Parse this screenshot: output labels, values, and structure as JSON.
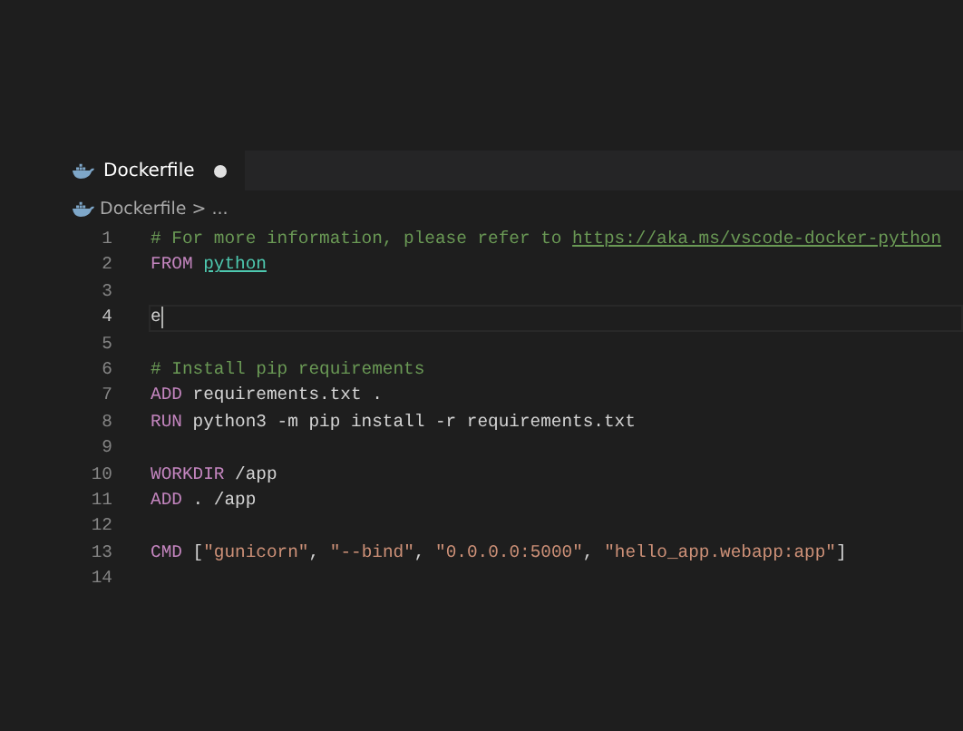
{
  "tabs": [
    {
      "label": "Dockerfile",
      "selected": true,
      "modified": true
    }
  ],
  "breadcrumb": {
    "file": "Dockerfile",
    "separator": ">",
    "more": "..."
  },
  "lines": [
    {
      "number": "1",
      "tokens": [
        {
          "kind": "comment",
          "text": "# For more information, please refer to "
        },
        {
          "kind": "link",
          "text": "https://aka.ms/vscode-docker-python"
        }
      ]
    },
    {
      "number": "2",
      "tokens": [
        {
          "kind": "keyword",
          "text": "FROM "
        },
        {
          "kind": "image",
          "text": "python"
        }
      ]
    },
    {
      "number": "3"
    },
    {
      "number": "4",
      "current": true,
      "tokens": [
        {
          "kind": "text",
          "text": "e"
        }
      ]
    },
    {
      "number": "5"
    },
    {
      "number": "6",
      "tokens": [
        {
          "kind": "comment",
          "text": "# Install pip requirements"
        }
      ]
    },
    {
      "number": "7",
      "tokens": [
        {
          "kind": "keyword",
          "text": "ADD"
        },
        {
          "kind": "text",
          "text": " requirements.txt ."
        }
      ]
    },
    {
      "number": "8",
      "tokens": [
        {
          "kind": "keyword",
          "text": "RUN"
        },
        {
          "kind": "text",
          "text": " python3 -m pip install -r requirements.txt"
        }
      ]
    },
    {
      "number": "9"
    },
    {
      "number": "10",
      "tokens": [
        {
          "kind": "keyword",
          "text": "WORKDIR"
        },
        {
          "kind": "text",
          "text": " /app"
        }
      ]
    },
    {
      "number": "11",
      "tokens": [
        {
          "kind": "keyword",
          "text": "ADD"
        },
        {
          "kind": "text",
          "text": " . /app"
        }
      ]
    },
    {
      "number": "12"
    },
    {
      "number": "13",
      "tokens": [
        {
          "kind": "keyword",
          "text": "CMD"
        },
        {
          "kind": "text",
          "text": " ["
        },
        {
          "kind": "string",
          "text": "\"gunicorn\""
        },
        {
          "kind": "text",
          "text": ", "
        },
        {
          "kind": "string",
          "text": "\"--bind\""
        },
        {
          "kind": "text",
          "text": ", "
        },
        {
          "kind": "string",
          "text": "\"0.0.0.0:5000\""
        },
        {
          "kind": "text",
          "text": ", "
        },
        {
          "kind": "string",
          "text": "\"hello_app.webapp:app\""
        },
        {
          "kind": "text",
          "text": "]"
        }
      ]
    },
    {
      "number": "14"
    }
  ]
}
